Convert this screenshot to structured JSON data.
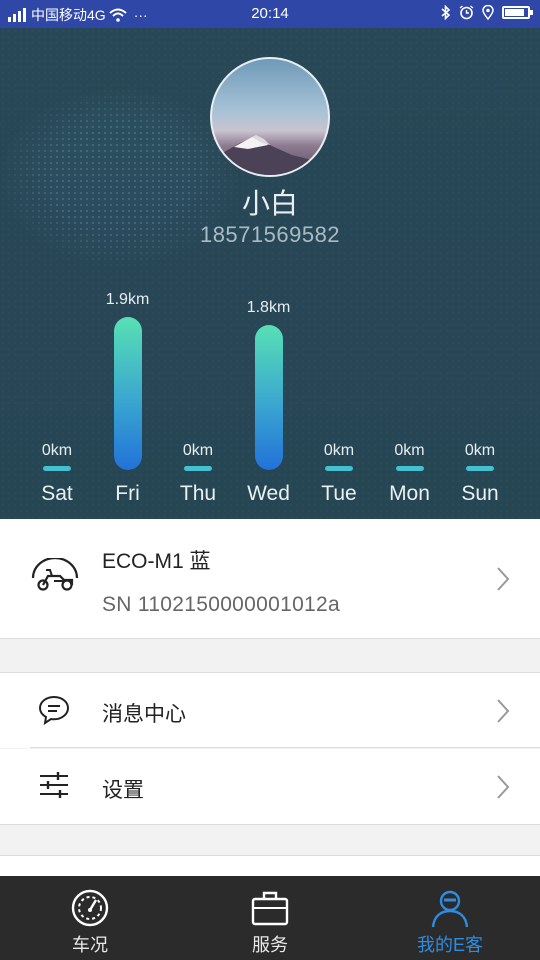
{
  "status_bar": {
    "carrier": "中国移动4G",
    "more": "···",
    "time": "20:14",
    "battery_level": 0.85,
    "icons": [
      "signal-icon",
      "wifi-icon",
      "bluetooth-icon",
      "alarm-icon",
      "location-icon",
      "battery-icon"
    ]
  },
  "profile": {
    "name": "小白",
    "phone": "18571569582"
  },
  "weekly_distance": {
    "max_value_km": 1.9,
    "days": [
      {
        "day": "Sat",
        "value": 0,
        "label": "0km"
      },
      {
        "day": "Fri",
        "value": 1.9,
        "label": "1.9km"
      },
      {
        "day": "Thu",
        "value": 0,
        "label": "0km"
      },
      {
        "day": "Wed",
        "value": 1.8,
        "label": "1.8km"
      },
      {
        "day": "Tue",
        "value": 0,
        "label": "0km"
      },
      {
        "day": "Mon",
        "value": 0,
        "label": "0km"
      },
      {
        "day": "Sun",
        "value": 0,
        "label": "0km"
      }
    ]
  },
  "device": {
    "name": "ECO-M1 蓝",
    "serial": "SN 1102150000001012a",
    "icon": "scooter-icon"
  },
  "menu": [
    {
      "label": "消息中心",
      "icon": "message-icon"
    },
    {
      "label": "设置",
      "icon": "settings-sliders-icon"
    }
  ],
  "tabs": [
    {
      "label": "车况",
      "icon": "speedometer-icon",
      "active": false
    },
    {
      "label": "服务",
      "icon": "briefcase-icon",
      "active": false
    },
    {
      "label": "我的E客",
      "icon": "user-icon",
      "active": true
    }
  ],
  "colors": {
    "status_bar": "#2f47a6",
    "accent": "#2e8de0",
    "tabbar": "#2b2b2b"
  }
}
